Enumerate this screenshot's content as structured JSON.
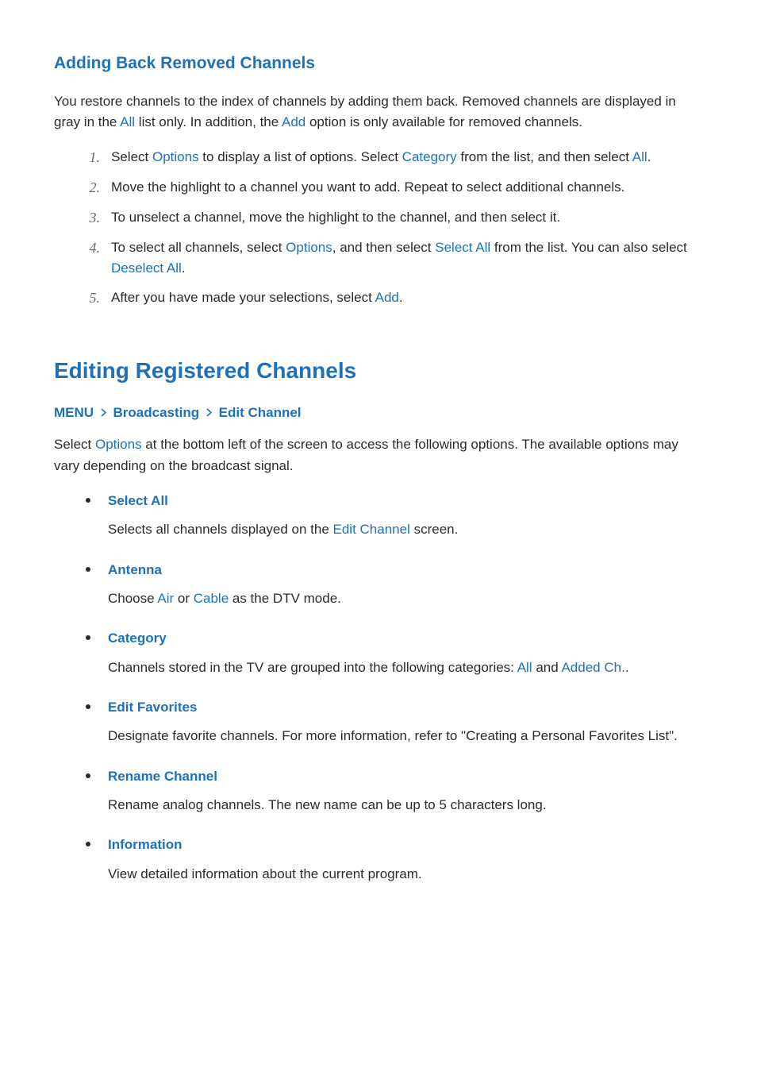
{
  "section1": {
    "title": "Adding Back Removed Channels",
    "intro_a": "You restore channels to the index of channels by adding them back. Removed channels are displayed in gray in the ",
    "intro_hl1": "All",
    "intro_b": " list only. In addition, the ",
    "intro_hl2": "Add",
    "intro_c": " option is only available for removed channels.",
    "steps": {
      "n1": "1.",
      "s1a": "Select ",
      "s1hl1": "Options",
      "s1b": " to display a list of options. Select ",
      "s1hl2": "Category",
      "s1c": " from the list, and then select ",
      "s1hl3": "All",
      "s1d": ".",
      "n2": "2.",
      "s2": "Move the highlight to a channel you want to add. Repeat to select additional channels.",
      "n3": "3.",
      "s3": "To unselect a channel, move the highlight to the channel, and then select it.",
      "n4": "4.",
      "s4a": "To select all channels, select ",
      "s4hl1": "Options",
      "s4b": ", and then select ",
      "s4hl2": "Select All",
      "s4c": " from the list. You can also select ",
      "s4hl3": "Deselect All",
      "s4d": ".",
      "n5": "5.",
      "s5a": "After you have made your selections, select ",
      "s5hl1": "Add",
      "s5b": "."
    }
  },
  "section2": {
    "title": "Editing Registered Channels",
    "breadcrumb": {
      "a": "MENU",
      "b": "Broadcasting",
      "c": "Edit Channel"
    },
    "intro_a": "Select ",
    "intro_hl1": "Options",
    "intro_b": " at the bottom left of the screen to access the following options. The available options may vary depending on the broadcast signal.",
    "items": {
      "i1_title": "Select All",
      "i1_a": "Selects all channels displayed on the ",
      "i1_hl1": "Edit Channel",
      "i1_b": " screen.",
      "i2_title": "Antenna",
      "i2_a": "Choose ",
      "i2_hl1": "Air",
      "i2_b": " or ",
      "i2_hl2": "Cable",
      "i2_c": " as the DTV mode.",
      "i3_title": "Category",
      "i3_a": "Channels stored in the TV are grouped into the following categories: ",
      "i3_hl1": "All",
      "i3_b": " and ",
      "i3_hl2": "Added Ch.",
      "i3_c": ".",
      "i4_title": "Edit Favorites",
      "i4_a": "Designate favorite channels. For more information, refer to \"Creating a Personal Favorites List\".",
      "i5_title": "Rename Channel",
      "i5_a": "Rename analog channels. The new name can be up to 5 characters long.",
      "i6_title": "Information",
      "i6_a": "View detailed information about the current program."
    }
  }
}
